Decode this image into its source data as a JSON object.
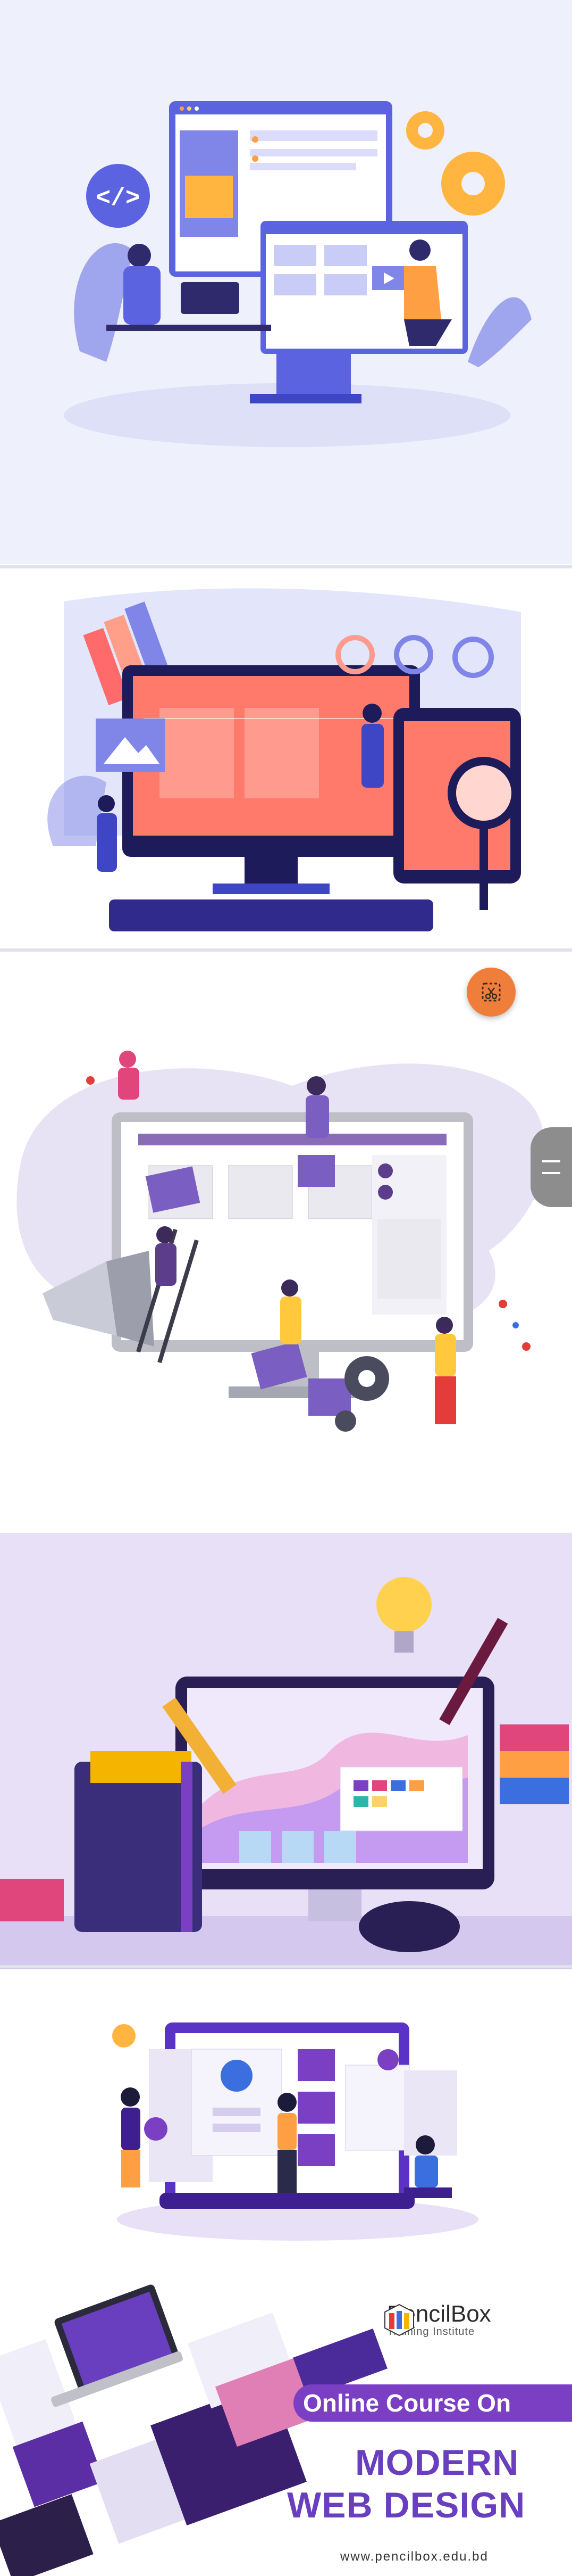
{
  "floating_button": {
    "icon": "scissors-crop-icon",
    "color": "#f07e3b"
  },
  "side_handle": {
    "icon": "drag-handle-icon"
  },
  "banner": {
    "brand_name": "PencilBox",
    "brand_tagline": "Training Institute",
    "ribbon_text": "Online Course On",
    "headline_line1": "MODERN",
    "headline_line2": "WEB DESIGN",
    "website": "www.pencilbox.edu.bd",
    "accent": "#7b3fc4"
  },
  "illustrations": {
    "code_badge": "</>"
  }
}
